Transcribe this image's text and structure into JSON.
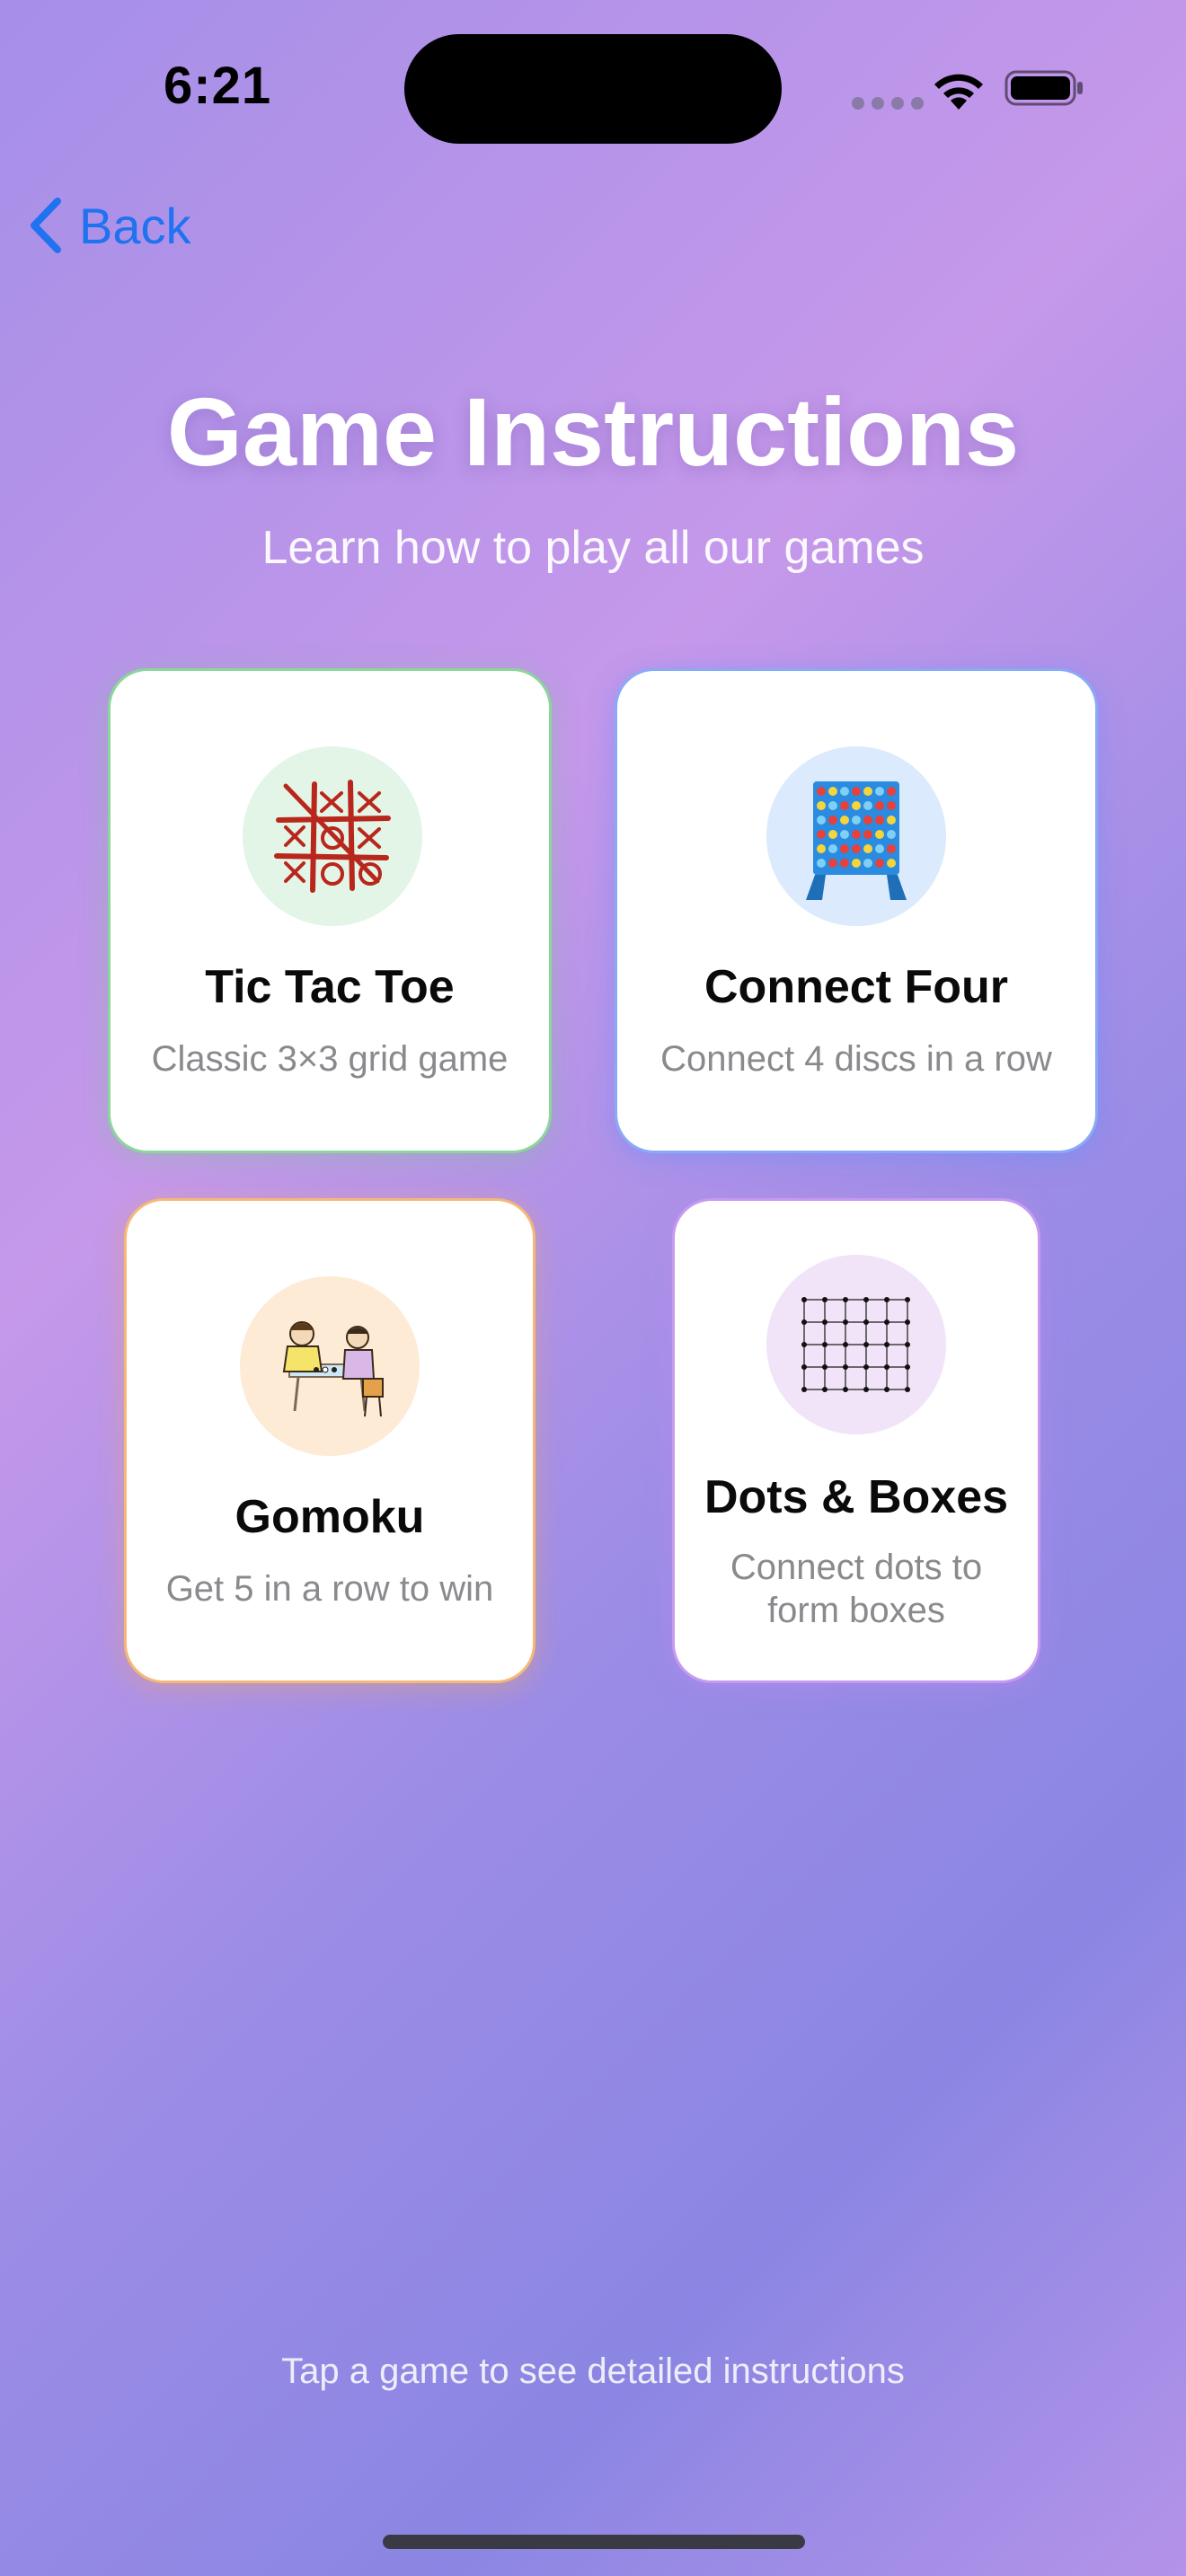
{
  "status_bar": {
    "time": "6:21"
  },
  "nav": {
    "back_label": "Back"
  },
  "header": {
    "title": "Game Instructions",
    "subtitle": "Learn how to play all our games"
  },
  "games": [
    {
      "name": "Tic Tac Toe",
      "description": "Classic 3×3 grid game",
      "icon": "tic-tac-toe-icon",
      "accent": "#8bd79a",
      "badge_color": "#e3f5e6"
    },
    {
      "name": "Connect Four",
      "description": "Connect 4 discs in a row",
      "icon": "connect-four-icon",
      "accent": "#8aaaf7",
      "badge_color": "#dbeafc"
    },
    {
      "name": "Gomoku",
      "description": "Get 5 in a row to win",
      "icon": "gomoku-players-icon",
      "accent": "#f5b877",
      "badge_color": "#fdebd6"
    },
    {
      "name": "Dots & Boxes",
      "description": "Connect dots to form boxes",
      "icon": "dots-grid-icon",
      "accent": "#c79af0",
      "badge_color": "#f2e4f8"
    }
  ],
  "footer": {
    "hint": "Tap a game to see detailed instructions"
  },
  "colors": {
    "back_link": "#1f72f0",
    "title_text": "#ffffff",
    "desc_text": "#8a8a8e"
  }
}
